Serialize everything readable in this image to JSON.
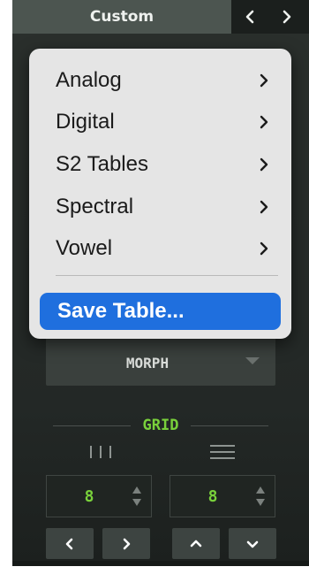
{
  "header": {
    "title": "Custom",
    "prev_icon": "chevron-left-icon",
    "next_icon": "chevron-right-icon"
  },
  "menu": {
    "items": [
      {
        "label": "Analog",
        "submenu": true
      },
      {
        "label": "Digital",
        "submenu": true
      },
      {
        "label": "S2 Tables",
        "submenu": true
      },
      {
        "label": "Spectral",
        "submenu": true
      },
      {
        "label": "Vowel",
        "submenu": true
      }
    ],
    "save_label": "Save Table...",
    "highlight_color": "#1f6fde"
  },
  "morph": {
    "value": "MORPH"
  },
  "grid": {
    "title": "GRID",
    "accent_color": "#79d13b",
    "vertical_icon": "vertical-lines-icon",
    "horizontal_icon": "horizontal-lines-icon",
    "x_value": "8",
    "y_value": "8"
  },
  "buttons": {
    "left_icon": "chevron-left-icon",
    "right_icon": "chevron-right-icon",
    "up_icon": "chevron-up-icon",
    "down_icon": "chevron-down-icon"
  }
}
